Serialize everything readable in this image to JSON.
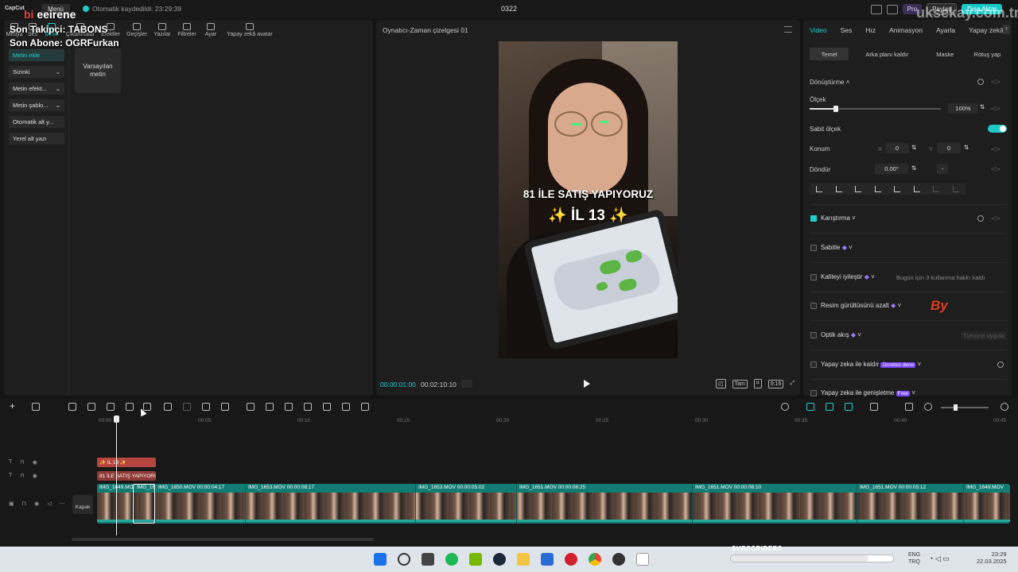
{
  "overlay": {
    "followers": "Son Takipçi: TABONS",
    "subscriber": "Son Abone: OGRFurkan",
    "brand_prefix": "bi",
    "brand_name": "eeirene",
    "watermark": "uksekay.com.tr",
    "by_sign": "By",
    "subs_label": "SUBSCRIBERS",
    "subs_progress": 0.85
  },
  "topbar": {
    "logo": "CapCut",
    "menu_label": "Menü",
    "autosave_text": "Otomatik kaydedildi: 23:29:39",
    "project_title": "0322",
    "pro_label": "Pro",
    "share_label": "Paylaş",
    "export_label": "Dışa Aktar"
  },
  "tools": [
    {
      "label": "Medya"
    },
    {
      "label": "Ses"
    },
    {
      "label": "Metin"
    },
    {
      "label": "Çıkartmalar"
    },
    {
      "label": "Efektler"
    },
    {
      "label": "Geçişler"
    },
    {
      "label": "Yazılar"
    },
    {
      "label": "Filtreler"
    },
    {
      "label": "Ayar"
    },
    {
      "label": "Yapay zekâ avatar"
    }
  ],
  "text_sidebar": {
    "items": [
      {
        "label": "Metin ekle"
      },
      {
        "label": "Sizinki"
      },
      {
        "label": "Metin efekt..."
      },
      {
        "label": "Metin şablo..."
      },
      {
        "label": "Otomatik alt y..."
      },
      {
        "label": "Yerel alt yazı"
      }
    ],
    "default_card": "Varsayılan metin"
  },
  "player": {
    "title": "Oynatıcı-Zaman çizelgesi 01",
    "caption_line1": "81 İLE SATIŞ YAPIYORUZ",
    "caption_line2": "✨ İL 13 ✨",
    "current_time": "00:00:01:00",
    "duration": "00:02:10:10",
    "ratio_label": "Tam",
    "aspect_label": "9:16"
  },
  "inspector": {
    "tabs": [
      "Video",
      "Ses",
      "Hız",
      "Animasyon",
      "Ayarla",
      "Yapay zekâ"
    ],
    "subtabs": [
      "Temel",
      "Arka planı kaldır",
      "Maske",
      "Rötuş yap"
    ],
    "transform_label": "Dönüştürme",
    "scale_label": "Ölçek",
    "scale_value": "100%",
    "scale_fraction": 0.2,
    "fixed_scale_label": "Sabit ölçek",
    "position_label": "Konum",
    "pos_x_label": "X",
    "pos_x": "0",
    "pos_y_label": "Y",
    "pos_y": "0",
    "rotate_label": "Döndür",
    "rotate_value": "0.00°",
    "blend_label": "Karıştırma",
    "stabilize_label": "Sabitle",
    "enhance_label": "Kaliteyi iyileştir",
    "enhance_note": "Bugün için 3 kullanma hakkı kaldı",
    "denoise_label": "Resim gürültüsünü azalt",
    "optical_label": "Optik akış",
    "optical_note": "Tümüne uygula",
    "ai_remove_label": "Yapay zeka ile kaldır",
    "ai_remove_badge": "Ücretsiz dene",
    "ai_expand_label": "Yapay zeka ile genişletme",
    "ai_expand_badge": "Free"
  },
  "timeline": {
    "ruler": [
      "00:00",
      "00:05",
      "00:10",
      "00:15",
      "00:20",
      "00:25",
      "00:30",
      "00:35",
      "00:40",
      "00:45"
    ],
    "text_clip_1": "✨ İL 13 ✨",
    "text_clip_2": "81 İLE SATIŞ YAPIYORU",
    "cover_label": "Kapak",
    "clips": [
      {
        "label": "IMG_1649.MO"
      },
      {
        "label": "IMG_16"
      },
      {
        "label": "IMG_1650.MOV  00:00:04:17"
      },
      {
        "label": "IMG_1653.MOV  00:00:08:17"
      },
      {
        "label": "IMG_1653.MOV  00:00:05:02"
      },
      {
        "label": "IMG_1651.MOV  00:00:08:25"
      },
      {
        "label": "IMG_1651.MOV  00:00:08:10"
      },
      {
        "label": "IMG_1651.MOV  00:00:05:12"
      },
      {
        "label": "IMG_1649.MOV"
      }
    ]
  },
  "taskbar": {
    "lang1": "ENG",
    "lang2": "TRQ",
    "time": "23:29",
    "date": "22.03.2025"
  },
  "colors": {
    "accent": "#1fd0d0",
    "export": "#19c9c9",
    "text_clip": "#b4453f",
    "video_track": "#127c74"
  }
}
